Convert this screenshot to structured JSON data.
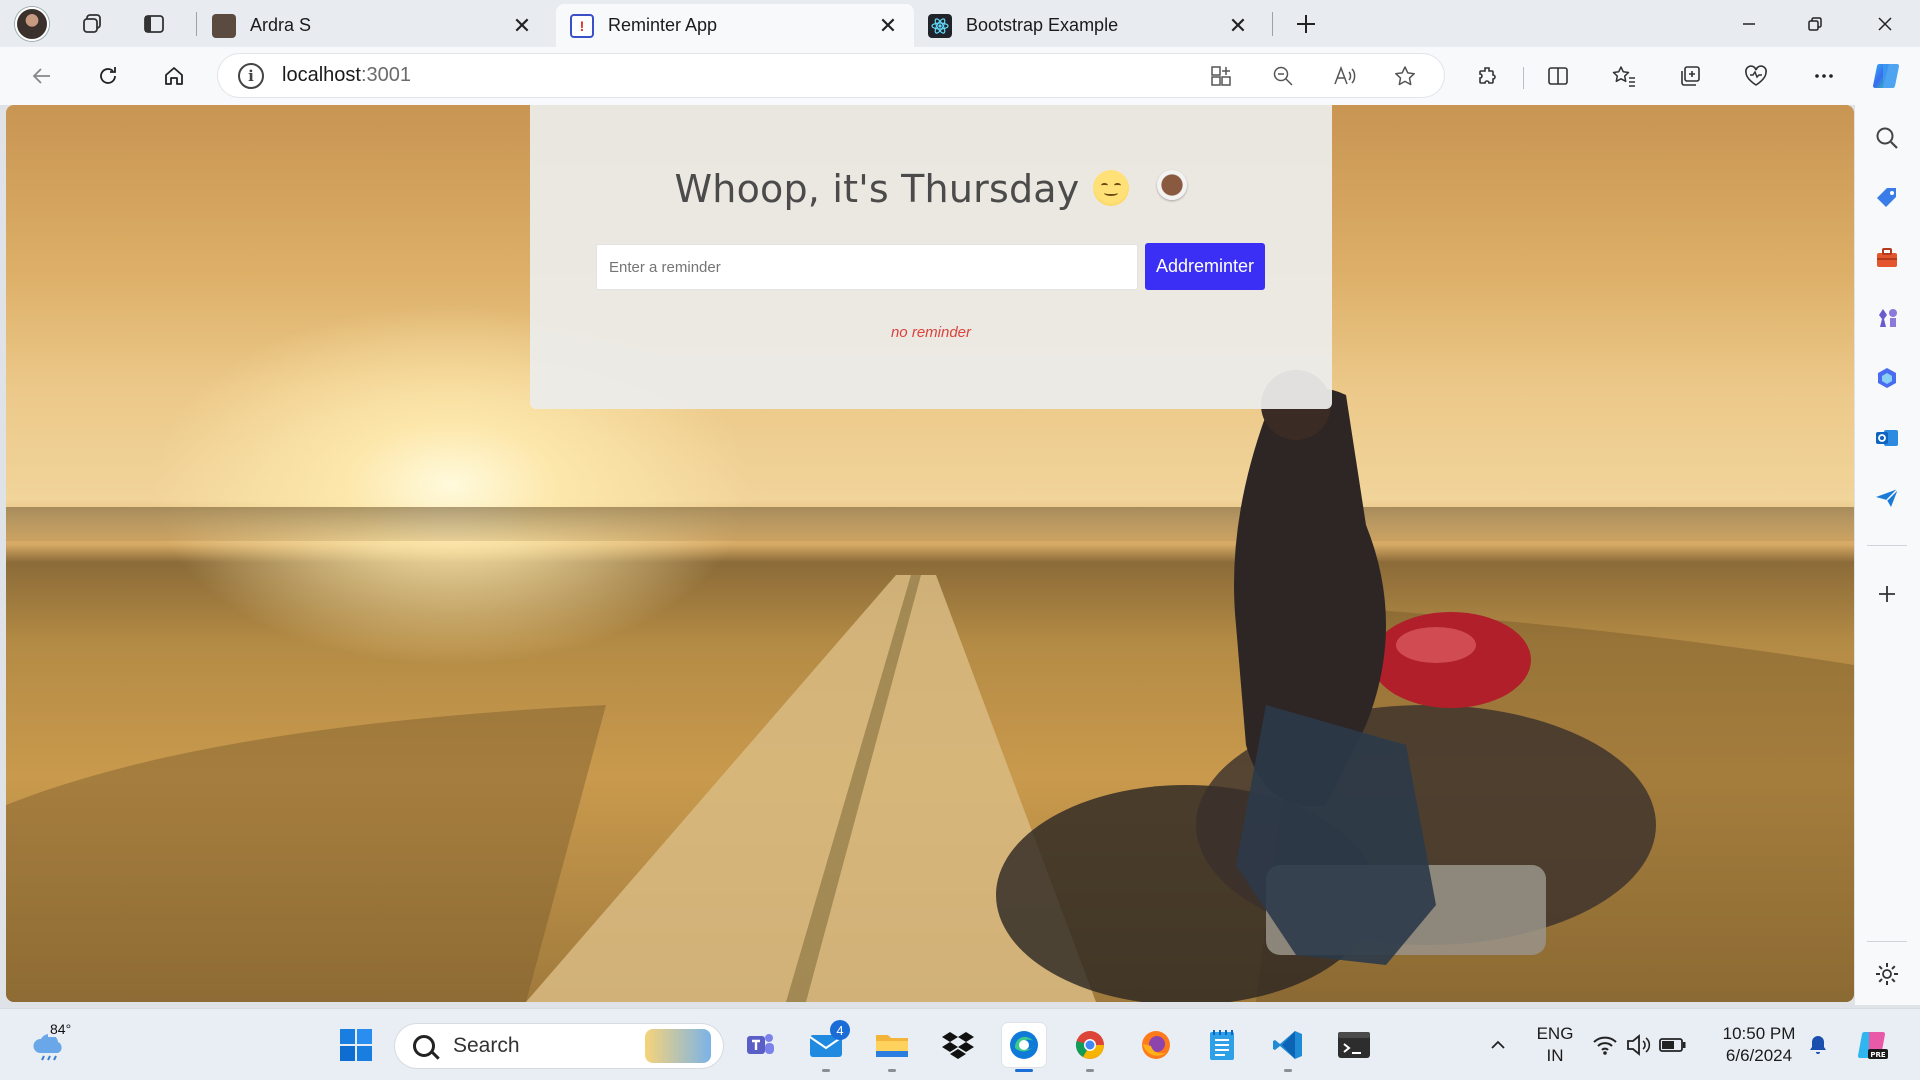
{
  "browser": {
    "tabs": [
      {
        "label": "Ardra S",
        "favicon": "profile-photo-icon"
      },
      {
        "label": "Reminter App",
        "favicon": "reminter-app-icon",
        "active": true
      },
      {
        "label": "Bootstrap Example",
        "favicon": "react-icon"
      }
    ],
    "address": {
      "host": "localhost",
      "port": ":3001"
    }
  },
  "app": {
    "title": "Whoop, it's Thursday",
    "input_placeholder": "Enter a reminder",
    "input_value": "",
    "add_button_label": "Addreminter",
    "empty_message": "no reminder"
  },
  "taskbar": {
    "weather_temp": "84°",
    "search_label": "Search",
    "mail_badge": "4",
    "language_line1": "ENG",
    "language_line2": "IN",
    "time": "10:50 PM",
    "date": "6/6/2024"
  },
  "colors": {
    "add_button": "#3b2ff5",
    "empty_message": "#d9433c",
    "card_background": "#ececea"
  }
}
